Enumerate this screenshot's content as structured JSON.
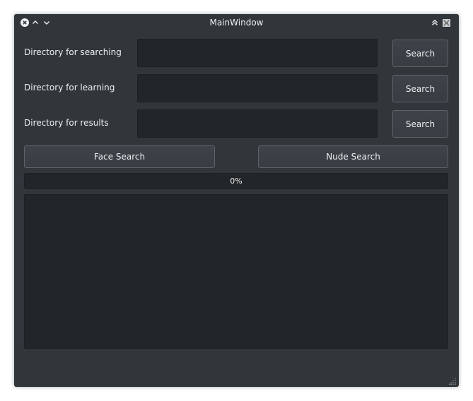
{
  "window": {
    "title": "MainWindow"
  },
  "titlebar": {
    "close_icon": "close-icon",
    "minimize_icon": "chevron-up-icon",
    "maximize_icon": "chevron-down-icon",
    "keep_above_icon": "double-chevron-up-icon",
    "app_icon": "app-icon"
  },
  "rows": [
    {
      "label": "Directory for searching",
      "value": "",
      "button": "Search"
    },
    {
      "label": "Directory for learning",
      "value": "",
      "button": "Search"
    },
    {
      "label": "Directory for results",
      "value": "",
      "button": "Search"
    }
  ],
  "actions": {
    "face_search": "Face Search",
    "nude_search": "Nude Search"
  },
  "progress": {
    "value": 0,
    "text": "0%"
  },
  "output": {
    "text": ""
  },
  "colors": {
    "window_bg": "#31363b",
    "field_bg": "#232629",
    "text": "#eff0f1",
    "accent": "#3daee9"
  }
}
